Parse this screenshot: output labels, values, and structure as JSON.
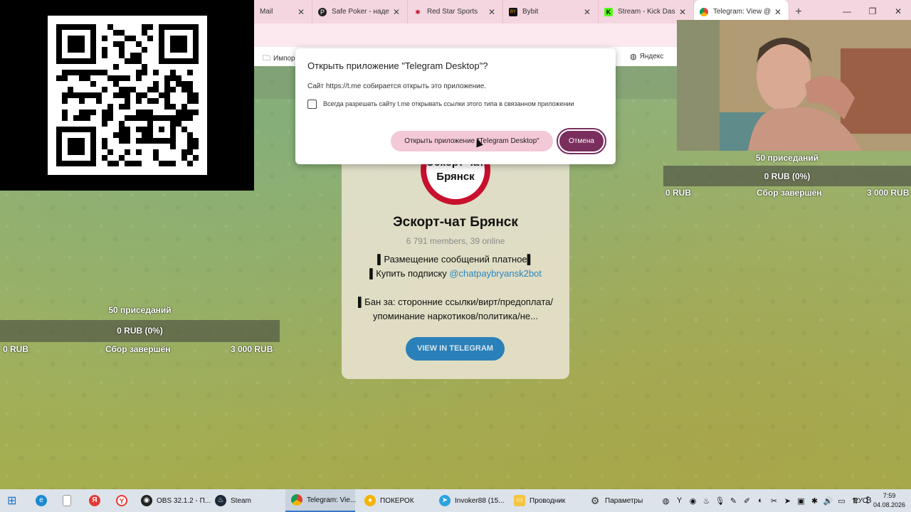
{
  "browser": {
    "tabs": [
      {
        "label": "Mail",
        "icon": "mail-icon"
      },
      {
        "label": "Safe Poker - наде",
        "icon": "poker-icon"
      },
      {
        "label": "Red Star Sports",
        "icon": "redstar-icon"
      },
      {
        "label": "Bybit",
        "icon": "bybit-icon"
      },
      {
        "label": "Stream - Kick Das",
        "icon": "kick-icon"
      },
      {
        "label": "Telegram: View @",
        "icon": "chrome-icon"
      }
    ],
    "new_tab": "+",
    "window_controls": [
      "—",
      "❐",
      "✕"
    ],
    "bookmarks": [
      {
        "label": "Импор",
        "icon": "folder-icon"
      },
      {
        "label": "Яндекс",
        "icon": "yandex-icon"
      }
    ]
  },
  "dialog": {
    "title": "Открыть приложение \"Telegram Desktop\"?",
    "message": "Сайт https://t.me собирается открыть это приложение.",
    "checkbox_label": "Всегда разрешать сайту t.me открывать ссылки этого типа в связанном приложении",
    "open_button": "Открыть приложение \"Telegram Desktop\"",
    "cancel_button": "Отмена"
  },
  "telegram": {
    "logo_line1": "Эскорт-чат",
    "logo_line2": "Брянск",
    "title": "Эскорт-чат Брянск",
    "members": "6 791 members, 39 online",
    "line1": "▌Размещение сообщений платное▌",
    "line2_prefix": "▌Купить подписку ",
    "line2_link": "@chatpaybryansk2bot",
    "line3": "▌Бан за: сторонние ссылки/вирт/предоплата/",
    "line4": "упоминание наркотиков/политика/не...",
    "button": "VIEW IN TELEGRAM"
  },
  "donation_top": {
    "goal": "50 приседаний",
    "progress": "0 RUB (0%)",
    "min": "0 RUB",
    "status": "Сбор завершён",
    "max": "3 000 RUB",
    "percent": 0
  },
  "donation_left": {
    "goal": "50 приседаний",
    "progress": "0 RUB (0%)",
    "min": "0 RUB",
    "status": "Сбор завершён",
    "max": "3 000 RUB",
    "percent": 0
  },
  "taskbar": {
    "items": [
      {
        "label": "OBS 32.1.2 - П...",
        "icon": "obs-icon"
      },
      {
        "label": "Steam",
        "icon": "steam-icon"
      },
      {
        "label": "Telegram: Vie...",
        "icon": "chrome-icon"
      },
      {
        "label": "ПОКЕРОК",
        "icon": "pokerok-icon"
      },
      {
        "label": "Invoker88 (15...",
        "icon": "telegram-icon"
      },
      {
        "label": "Проводник",
        "icon": "explorer-icon"
      },
      {
        "label": "Параметры",
        "icon": "settings-icon"
      }
    ],
    "lang": "РУС",
    "time": "7:59",
    "date": "04.08.2026"
  },
  "colors": {
    "accent": "#7a2e5e",
    "open_button": "#f3c8d7",
    "tg_button": "#2a80b9",
    "tg_link": "#2a86c2",
    "tab_bar": "#f4d6e0"
  }
}
